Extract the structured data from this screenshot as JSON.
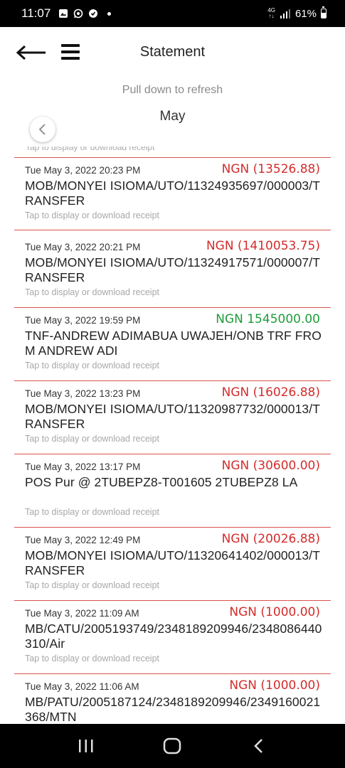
{
  "status_bar": {
    "time": "11:07",
    "network": "4G",
    "battery": "61%",
    "icons": [
      "gallery-icon",
      "whatsapp-icon",
      "vpn-icon",
      "notification-dot"
    ]
  },
  "header": {
    "title": "Statement",
    "back_icon": "arrow-left-icon",
    "menu_icon": "hamburger-menu-icon"
  },
  "refresh_hint": "Pull down to refresh",
  "month": "May",
  "partial_hint": "Tap to display or download receipt",
  "transactions": [
    {
      "date": "Tue May 3, 2022 20:23 PM",
      "amount": "NGN (13526.88)",
      "type": "debit",
      "desc": "MOB/MONYEI ISIOMA/UTO/11324935697/000003/TRANSFER",
      "hint": "Tap to display or download receipt"
    },
    {
      "date": "Tue May 3, 2022 20:21 PM",
      "amount": "NGN (1410053.75)",
      "type": "debit",
      "desc": "MOB/MONYEI ISIOMA/UTO/11324917571/000007/TRANSFER",
      "hint": "Tap to display or download receipt"
    },
    {
      "date": "Tue May 3, 2022 19:59 PM",
      "amount": "NGN 1545000.00",
      "type": "credit",
      "desc": "TNF-ANDREW ADIMABUA UWAJEH/ONB TRF FROM ANDREW ADI",
      "hint": "Tap to display or download receipt"
    },
    {
      "date": "Tue May 3, 2022 13:23 PM",
      "amount": "NGN (16026.88)",
      "type": "debit",
      "desc": "MOB/MONYEI ISIOMA/UTO/11320987732/000013/TRANSFER",
      "hint": "Tap to display or download receipt"
    },
    {
      "date": "Tue May 3, 2022 13:17 PM",
      "amount": "NGN (30600.00)",
      "type": "debit",
      "desc": "POS Pur @ 2TUBEPZ8-T001605 2TUBEPZ8 LA",
      "hint": "Tap to display or download receipt"
    },
    {
      "date": "Tue May 3, 2022 12:49 PM",
      "amount": "NGN (20026.88)",
      "type": "debit",
      "desc": "MOB/MONYEI ISIOMA/UTO/11320641402/000013/TRANSFER",
      "hint": "Tap to display or download receipt"
    },
    {
      "date": "Tue May 3, 2022 11:09 AM",
      "amount": "NGN (1000.00)",
      "type": "debit",
      "desc": "MB/CATU/2005193749/2348189209946/2348086440310/Air",
      "hint": "Tap to display or download receipt"
    },
    {
      "date": "Tue May 3, 2022 11:06 AM",
      "amount": "NGN (1000.00)",
      "type": "debit",
      "desc": "MB/PATU/2005187124/2348189209946/2349160021368/MTN",
      "hint": ""
    }
  ],
  "nav_bar": {
    "recents_icon": "recents-icon",
    "home_icon": "home-icon",
    "back_icon": "back-chevron-icon"
  }
}
